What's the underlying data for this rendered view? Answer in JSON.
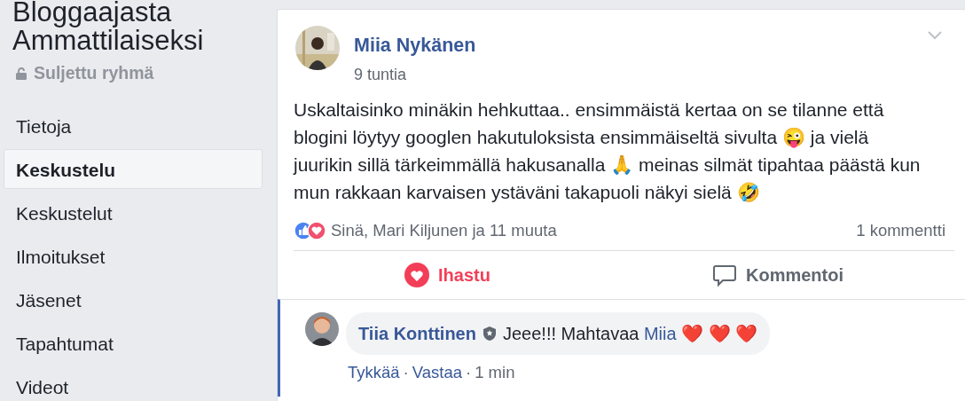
{
  "group": {
    "title_lines": [
      "Bloggaajasta",
      "Ammattilaiseksi"
    ],
    "privacy": "Suljettu ryhmä"
  },
  "sidebar": {
    "items": [
      {
        "label": "Tietoja",
        "selected": false
      },
      {
        "label": "Keskustelu",
        "selected": true
      },
      {
        "label": "Keskustelut",
        "selected": false
      },
      {
        "label": "Ilmoitukset",
        "selected": false
      },
      {
        "label": "Jäsenet",
        "selected": false
      },
      {
        "label": "Tapahtumat",
        "selected": false
      },
      {
        "label": "Videot",
        "selected": false
      }
    ]
  },
  "post": {
    "author": "Miia Nykänen",
    "time": "9 tuntia",
    "text": "Uskaltaisinko minäkin hehkuttaa.. ensimmäistä kertaa on se tilanne että blogini löytyy googlen hakutuloksista ensimmäiseltä sivulta 😜 ja vielä juurikin sillä tärkeimmällä hakusanalla 🙏 meinas silmät tipahtaa päästä kun mun rakkaan karvaisen ystäväni takapuoli näkyi sielä 🤣",
    "reactions": "Sinä, Mari Kiljunen ja 11 muuta",
    "comment_count": "1 kommentti",
    "actions": [
      {
        "kind": "love",
        "label": "Ihastu",
        "selected": true
      },
      {
        "kind": "comment",
        "label": "Kommentoi",
        "selected": false
      }
    ]
  },
  "comments": [
    {
      "author": "Tiia Konttinen",
      "text": "Jeee!!! Mahtavaa",
      "mention": "Miia",
      "hearts": "❤️ ❤️ ❤️",
      "links": [
        "Tykkää",
        "Vastaa"
      ],
      "separators": [
        "·",
        "·"
      ],
      "time": "1 min"
    }
  ]
}
